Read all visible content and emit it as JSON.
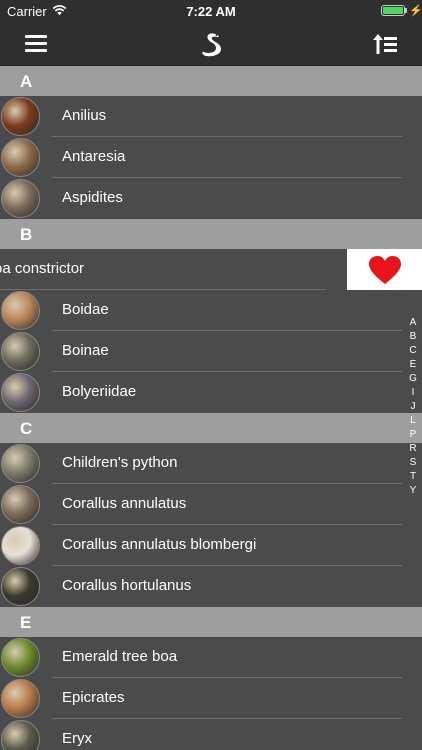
{
  "status_bar": {
    "carrier": "Carrier",
    "time": "7:22 AM",
    "battery_level": 1.0
  },
  "nav": {
    "menu_icon": "hamburger-menu-icon",
    "logo_icon": "snake-logo-icon",
    "sort_icon": "sort-icon"
  },
  "sections": [
    {
      "letter": "A",
      "items": [
        {
          "label": "Anilius",
          "color": "#7a3a1c"
        },
        {
          "label": "Antaresia",
          "color": "#8a6a4a"
        },
        {
          "label": "Aspidites",
          "color": "#7a6a5a"
        }
      ]
    },
    {
      "letter": "B",
      "items": [
        {
          "label": "Boa constrictor",
          "visible_label": "oa constrictor",
          "color": "#8b7355"
        },
        {
          "label": "Boidae",
          "color": "#b8835a"
        },
        {
          "label": "Boinae",
          "color": "#6a6a5a"
        },
        {
          "label": "Bolyeriidae",
          "color": "#6c6670"
        }
      ]
    },
    {
      "letter": "C",
      "items": [
        {
          "label": "Children's python",
          "color": "#7a7a6a"
        },
        {
          "label": "Corallus annulatus",
          "color": "#7a6a5a"
        },
        {
          "label": "Corallus annulatus blombergi",
          "color": "#e8e0d8"
        },
        {
          "label": "Corallus hortulanus",
          "color": "#3a3a2a"
        }
      ]
    },
    {
      "letter": "E",
      "items": [
        {
          "label": "Emerald tree boa",
          "color": "#6a8a2a"
        },
        {
          "label": "Epicrates",
          "color": "#b87a4a"
        },
        {
          "label": "Eryx",
          "color": "#5a5a4a"
        }
      ]
    }
  ],
  "favorite_action": {
    "icon": "heart-icon",
    "color": "#e8141a"
  },
  "index_letters": [
    "A",
    "B",
    "C",
    "E",
    "G",
    "I",
    "J",
    "L",
    "P",
    "R",
    "S",
    "T",
    "Y"
  ]
}
